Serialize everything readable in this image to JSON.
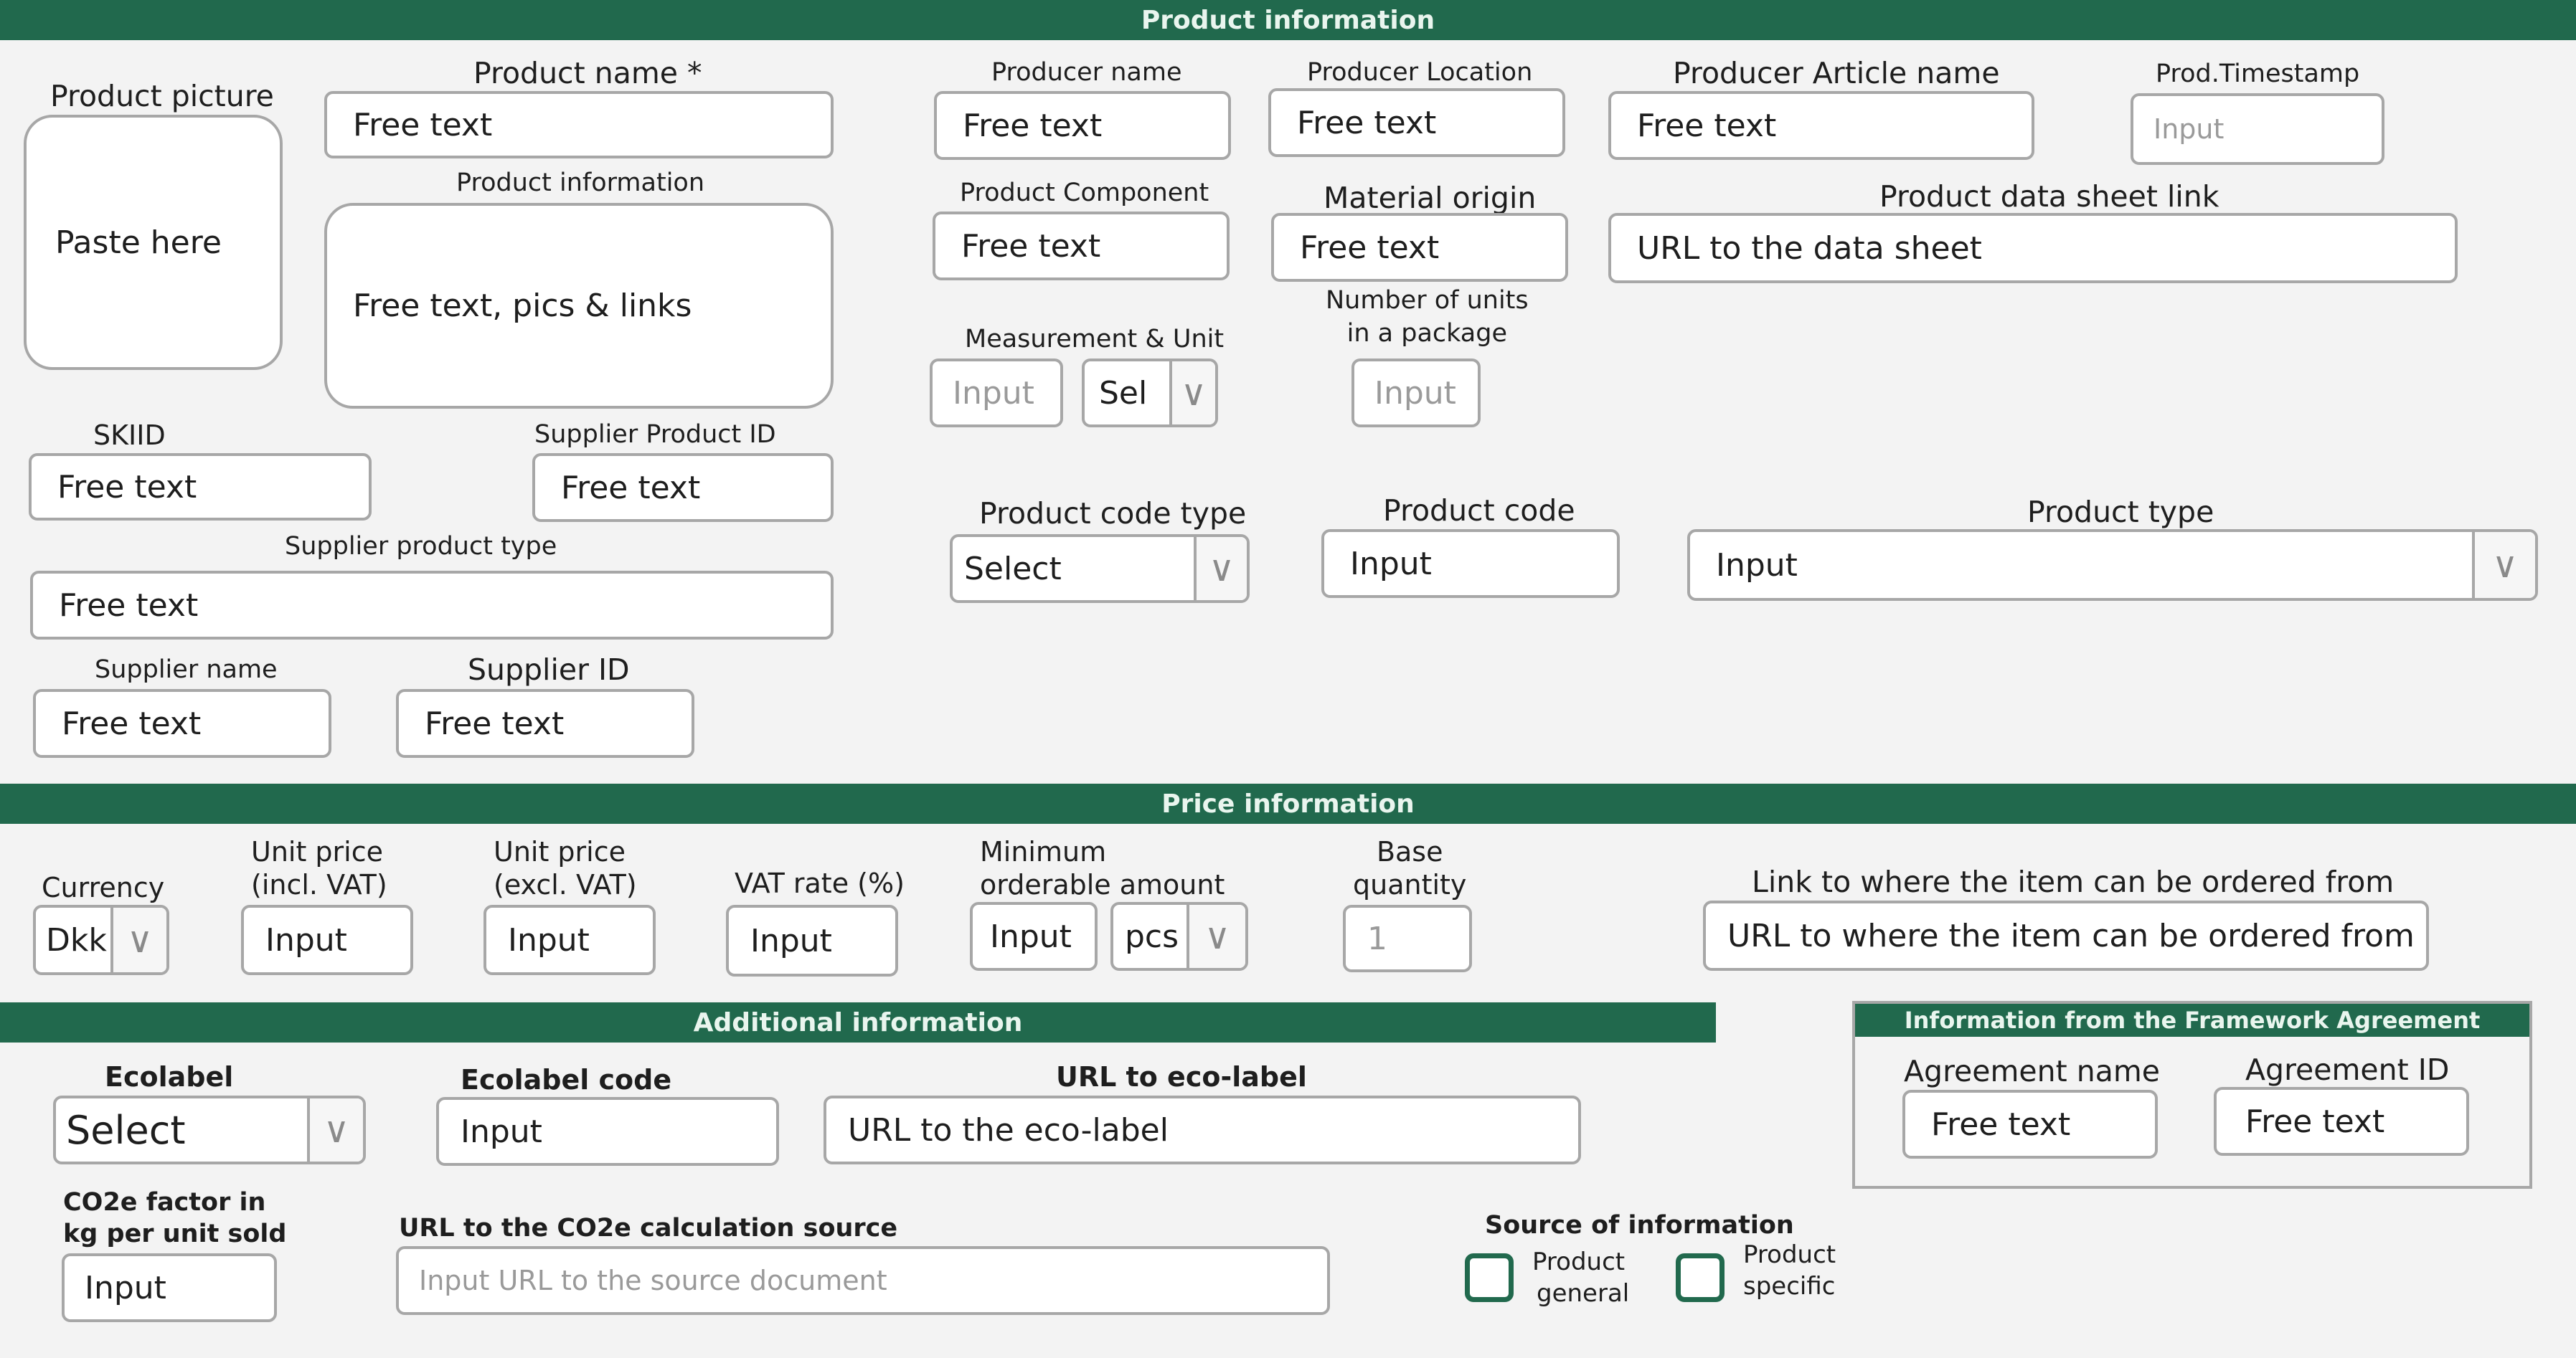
{
  "sections": {
    "product": "Product information",
    "price": "Price information",
    "additional": "Additional information",
    "framework": "Information from the Framework Agreement"
  },
  "product": {
    "picture": {
      "label": "Product picture",
      "value": "Paste here"
    },
    "name": {
      "label": "Product name *",
      "value": "Free text"
    },
    "info": {
      "label": "Product information",
      "value": "Free text, pics & links"
    },
    "skiid": {
      "label": "SKIID",
      "value": "Free text"
    },
    "supplier_product_id": {
      "label": "Supplier Product ID",
      "value": "Free text"
    },
    "supplier_product_type": {
      "label": "Supplier product type",
      "value": "Free text"
    },
    "supplier_name": {
      "label": "Supplier name",
      "value": "Free text"
    },
    "supplier_id": {
      "label": "Supplier ID",
      "value": "Free text"
    },
    "producer_name": {
      "label": "Producer name",
      "value": "Free text"
    },
    "producer_location": {
      "label": "Producer Location",
      "value": "Free text"
    },
    "producer_article": {
      "label": "Producer Article name",
      "value": "Free text"
    },
    "timestamp": {
      "label": "Prod.Timestamp",
      "placeholder": "Input"
    },
    "component": {
      "label": "Product Component",
      "value": "Free text"
    },
    "material_origin": {
      "label": "Material origin",
      "value": "Free text"
    },
    "datasheet": {
      "label": "Product data sheet link",
      "value": "URL to the data sheet"
    },
    "measurement": {
      "label": "Measurement & Unit",
      "placeholder": "Input",
      "unit": "Sel"
    },
    "units_pkg": {
      "label1": "Number of units",
      "label2": "in a package",
      "placeholder": "Input"
    },
    "code_type": {
      "label": "Product code type",
      "value": "Select"
    },
    "code": {
      "label": "Product code",
      "value": "Input"
    },
    "type": {
      "label": "Product type",
      "value": "Input"
    }
  },
  "price": {
    "currency": {
      "label": "Currency",
      "value": "Dkk"
    },
    "unit_incl": {
      "label1": "Unit price",
      "label2": "(incl. VAT)",
      "value": "Input"
    },
    "unit_excl": {
      "label1": "Unit price",
      "label2": "(excl. VAT)",
      "value": "Input"
    },
    "vat": {
      "label": "VAT rate (%)",
      "value": "Input"
    },
    "min_order": {
      "label1": "Minimum",
      "label2": "orderable amount",
      "value": "Input",
      "unit": "pcs"
    },
    "base_qty": {
      "label1": "Base",
      "label2": "quantity",
      "value": "1"
    },
    "order_link": {
      "label": "Link to where the item can be ordered from",
      "value": "URL to where the item can be ordered from"
    }
  },
  "additional": {
    "ecolabel": {
      "label": "Ecolabel",
      "value": "Select"
    },
    "ecolabel_code": {
      "label": "Ecolabel code",
      "value": "Input"
    },
    "eco_url": {
      "label": "URL to eco-label",
      "value": "URL to the eco-label"
    },
    "co2": {
      "label1": "CO2e factor in",
      "label2": "kg per unit sold",
      "value": "Input"
    },
    "co2_url": {
      "label": "URL to the CO2e calculation source",
      "placeholder": "Input URL to the source document"
    },
    "source": {
      "label": "Source of information",
      "general1": "Product",
      "general2": "general",
      "specific1": "Product",
      "specific2": "specific"
    }
  },
  "framework": {
    "agreement_name": {
      "label": "Agreement name",
      "value": "Free text"
    },
    "agreement_id": {
      "label": "Agreement ID",
      "value": "Free text"
    }
  },
  "colors": {
    "accent": "#21694d",
    "border": "#a7a7a7",
    "background": "#f3f3f3"
  },
  "icons": {
    "dropdown": "chevron-down-icon",
    "checkbox": "checkbox-icon"
  }
}
